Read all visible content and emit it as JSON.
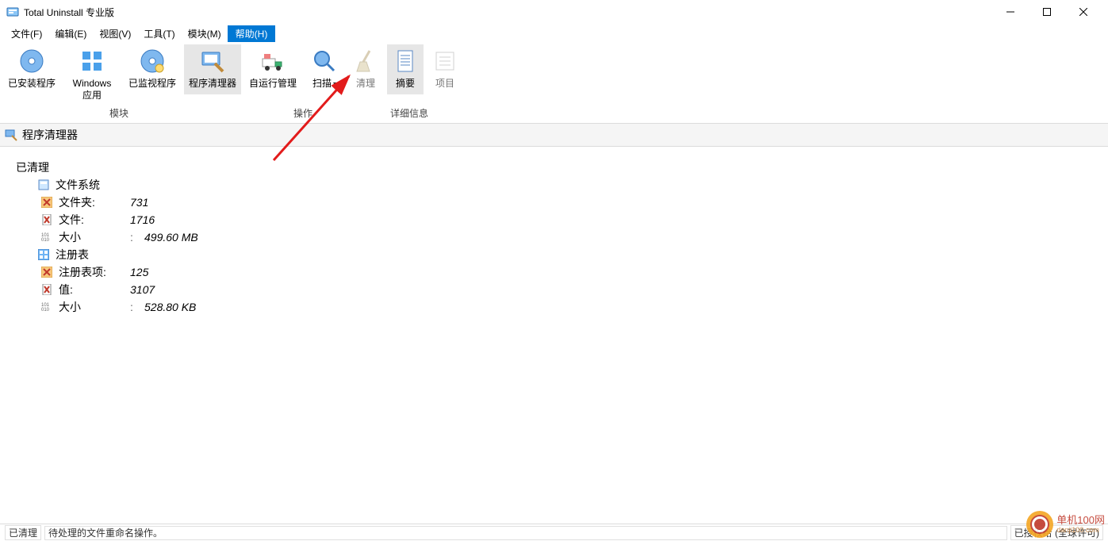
{
  "window": {
    "title": "Total Uninstall 专业版"
  },
  "menus": {
    "file": "文件(F)",
    "edit": "编辑(E)",
    "view": "视图(V)",
    "tools": "工具(T)",
    "modules": "模块(M)",
    "help": "帮助(H)"
  },
  "ribbon": {
    "installed": {
      "label": "已安装程序"
    },
    "winapps": {
      "label": "Windows\n应用"
    },
    "monitored": {
      "label": "已监视程序"
    },
    "cleaner": {
      "label": "程序清理器"
    },
    "autorun": {
      "label": "自运行管理"
    },
    "scan": {
      "label": "扫描"
    },
    "clean": {
      "label": "清理"
    },
    "summary": {
      "label": "摘要"
    },
    "project": {
      "label": "项目"
    },
    "group_modules": "模块",
    "group_ops": "操作",
    "group_details": "详细信息"
  },
  "section": {
    "title": "程序清理器"
  },
  "tree": {
    "root": "已清理",
    "fs": {
      "label": "文件系统",
      "folders_label": "文件夹:",
      "folders_val": "731",
      "files_label": "文件:",
      "files_val": "1716",
      "size_label": "大小",
      "size_val": "499.60 MB"
    },
    "reg": {
      "label": "注册表",
      "items_label": "注册表项:",
      "items_val": "125",
      "values_label": "值:",
      "values_val": "3107",
      "size_label": "大小",
      "size_val": "528.80 KB"
    },
    "sep": ":"
  },
  "status": {
    "left": "已清理",
    "message": "待处理的文件重命名操作。",
    "right": "已授权给 (全球许可)"
  },
  "watermark": {
    "text": "单机100网",
    "sub": "danji100.com"
  }
}
